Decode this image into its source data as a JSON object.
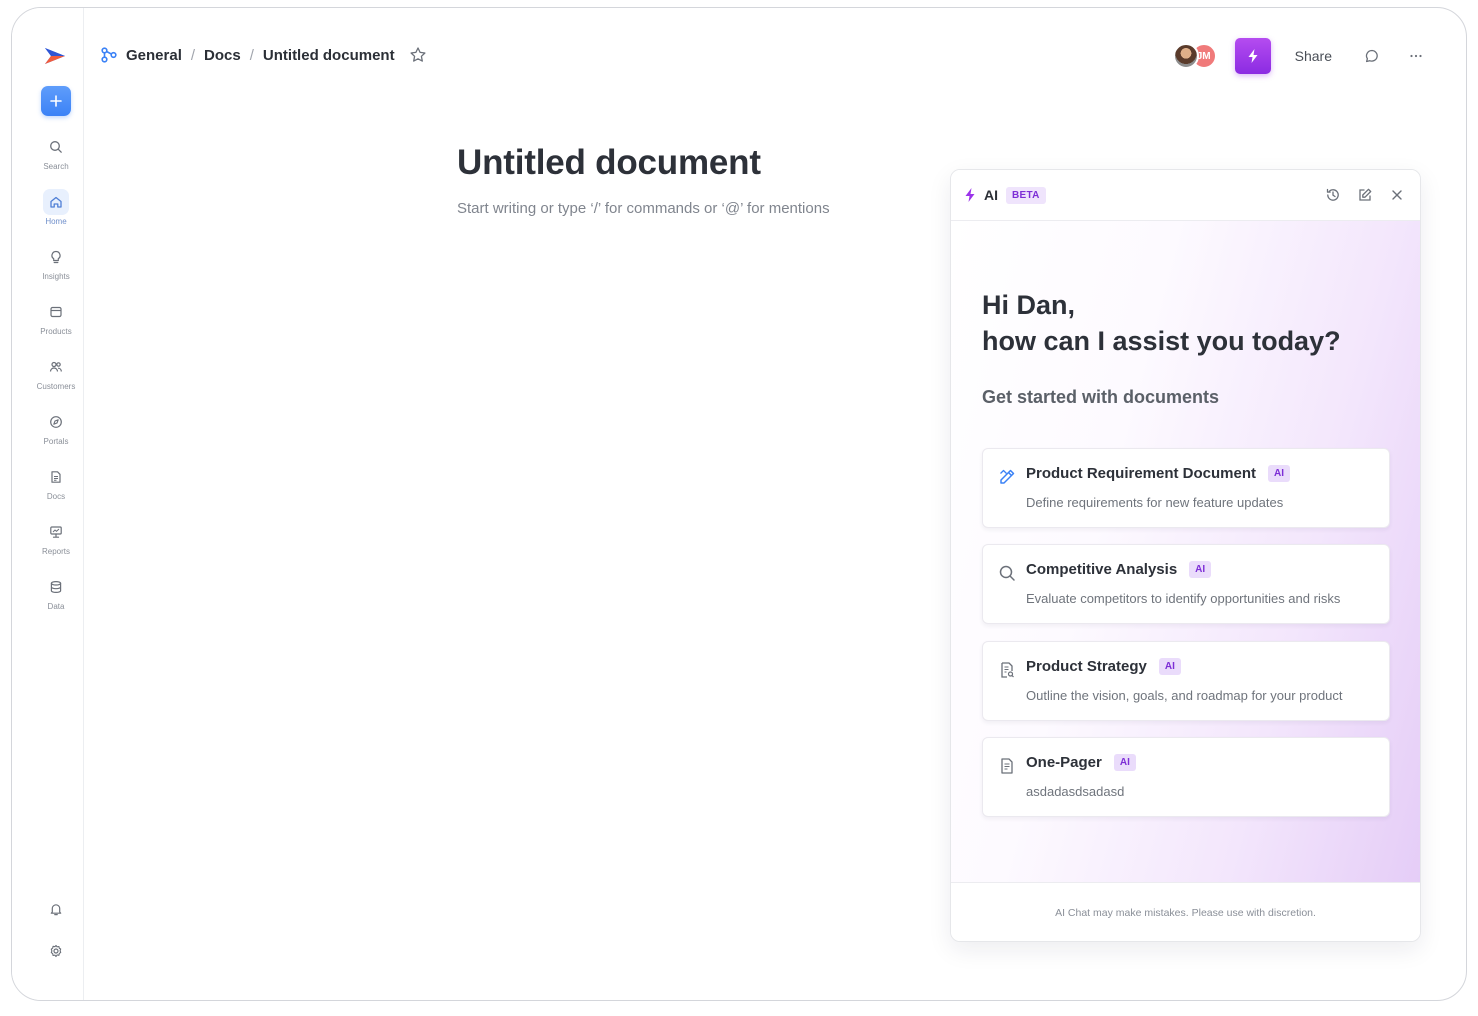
{
  "breadcrumb": {
    "items": [
      "General",
      "Docs",
      "Untitled document"
    ]
  },
  "topbar": {
    "avatar_initials": "JM",
    "share_label": "Share"
  },
  "sidebar": {
    "items": [
      {
        "label": "Search",
        "icon": "search-icon"
      },
      {
        "label": "Home",
        "icon": "home-icon",
        "active": true
      },
      {
        "label": "Insights",
        "icon": "lightbulb-icon"
      },
      {
        "label": "Products",
        "icon": "products-icon"
      },
      {
        "label": "Customers",
        "icon": "customers-icon"
      },
      {
        "label": "Portals",
        "icon": "compass-icon"
      },
      {
        "label": "Docs",
        "icon": "docs-icon"
      },
      {
        "label": "Reports",
        "icon": "reports-icon"
      },
      {
        "label": "Data",
        "icon": "database-icon"
      }
    ]
  },
  "editor": {
    "title": "Untitled document",
    "placeholder": "Start writing or type ‘/’ for commands or ‘@’ for mentions"
  },
  "ai_panel": {
    "title": "AI",
    "badge": "BETA",
    "greeting_line1": "Hi Dan,",
    "greeting_line2": "how can I assist you today?",
    "section_title": "Get started with documents",
    "cards": [
      {
        "title": "Product Requirement Document",
        "tag": "AI",
        "description": "Define requirements for new feature updates",
        "icon": "pencil-ruler-icon"
      },
      {
        "title": "Competitive Analysis",
        "tag": "AI",
        "description": "Evaluate competitors to identify opportunities and risks",
        "icon": "search-icon"
      },
      {
        "title": "Product Strategy",
        "tag": "AI",
        "description": "Outline the vision, goals, and roadmap for your product",
        "icon": "strategy-doc-icon"
      },
      {
        "title": "One-Pager",
        "tag": "AI",
        "description": "asdadasdsadasd",
        "icon": "document-icon"
      }
    ],
    "footer": "AI Chat may make mistakes. Please use with discretion."
  },
  "colors": {
    "accent_blue": "#3b82f6",
    "ai_purple": "#8b2be2",
    "badge_purple": "#7d2ed6"
  }
}
